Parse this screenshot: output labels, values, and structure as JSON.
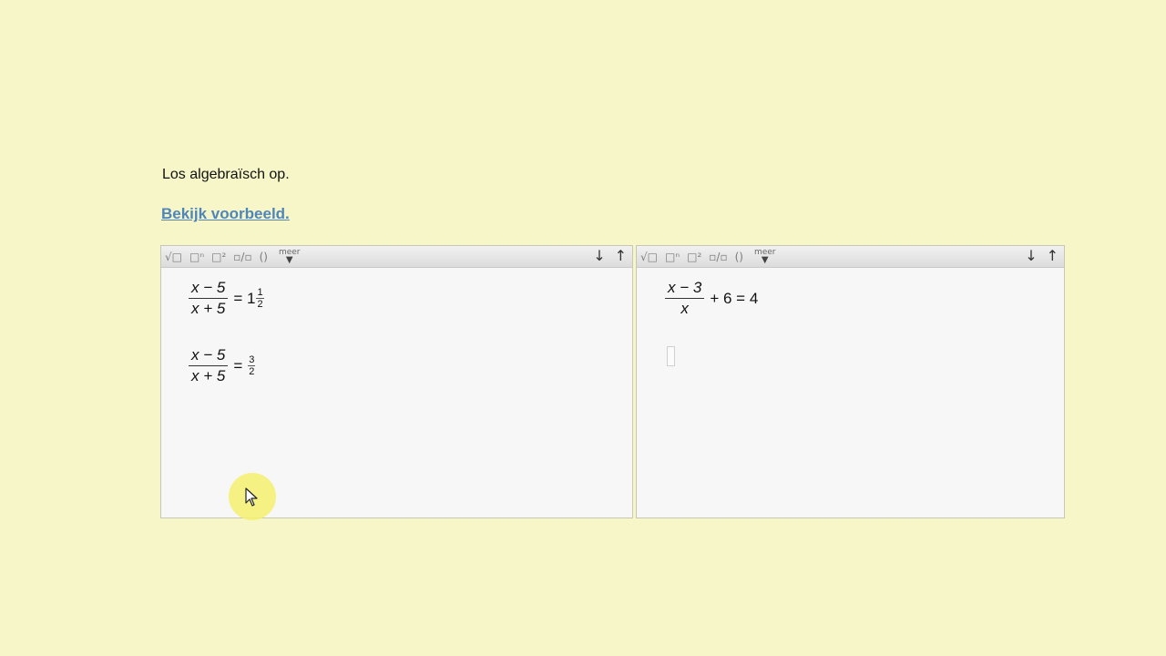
{
  "instruction": "Los algebraïsch op.",
  "example_link": "Bekijk voorbeeld.",
  "toolbar": {
    "tools": [
      "√□",
      "□ⁿ",
      "□²",
      "▫/▫",
      "()"
    ],
    "more_label": "meer",
    "down_arrow": "↓",
    "up_arrow": "↑"
  },
  "left_editor": {
    "eq1": {
      "num": "x − 5",
      "den": "x + 5",
      "rhs_prefix": "= 1",
      "mixed_num": "1",
      "mixed_den": "2"
    },
    "eq2": {
      "num": "x − 5",
      "den": "x + 5",
      "rhs_prefix": "=",
      "frac_num": "3",
      "frac_den": "2"
    }
  },
  "right_editor": {
    "eq1": {
      "num": "x − 3",
      "den": "x",
      "rhs": "+ 6 = 4"
    }
  }
}
